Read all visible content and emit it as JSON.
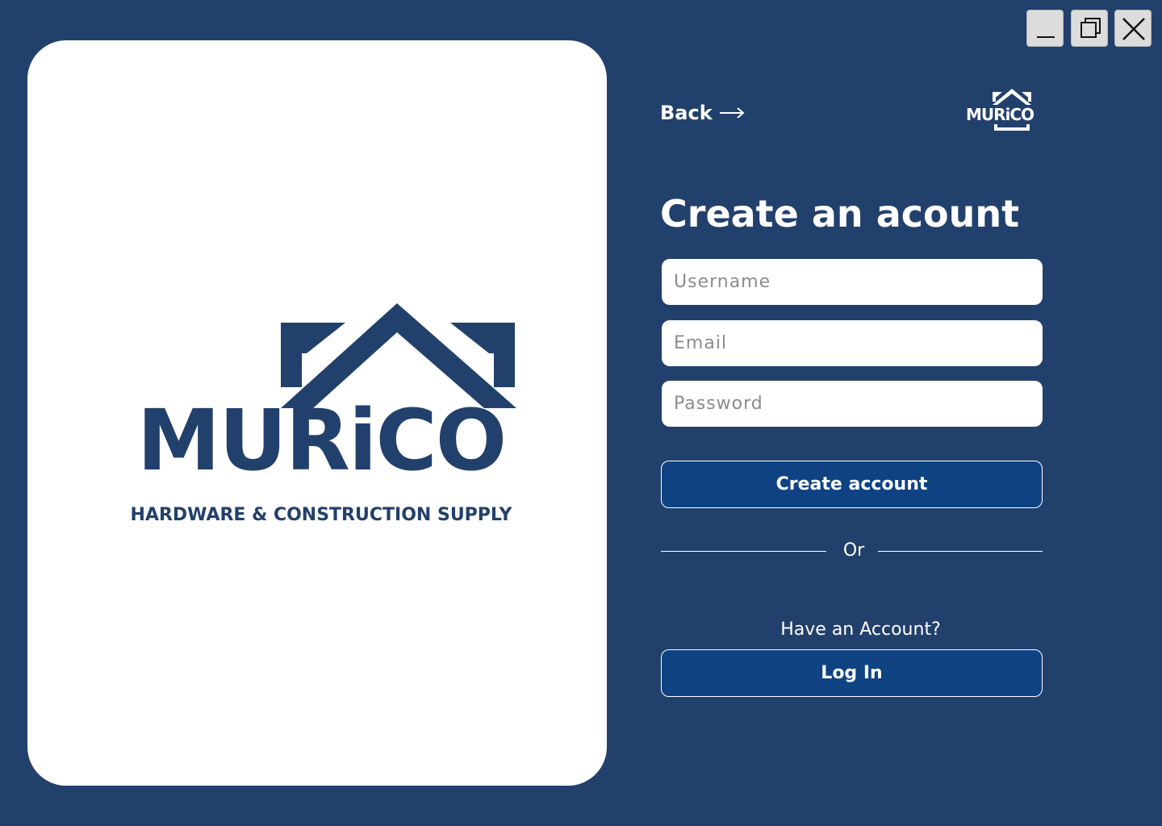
{
  "window": {
    "controls": [
      {
        "name": "minimize-icon"
      },
      {
        "name": "restore-icon"
      },
      {
        "name": "close-icon"
      }
    ]
  },
  "brand": {
    "wordmark": "MURiCO",
    "tagline": "HARDWARE & CONSTRUCTION SUPPLY",
    "logo_color": "#22406c"
  },
  "header": {
    "back_label": "Back",
    "back_icon": "arrow-right-icon"
  },
  "form": {
    "title": "Create an acount",
    "username_placeholder": "Username",
    "email_placeholder": "Email",
    "password_placeholder": "Password",
    "submit_label": "Create account",
    "divider_text": "Or",
    "have_account_text": "Have an Account?",
    "login_label": "Log In"
  },
  "colors": {
    "background": "#22406c",
    "button": "#0e4282",
    "card": "#ffffff"
  }
}
